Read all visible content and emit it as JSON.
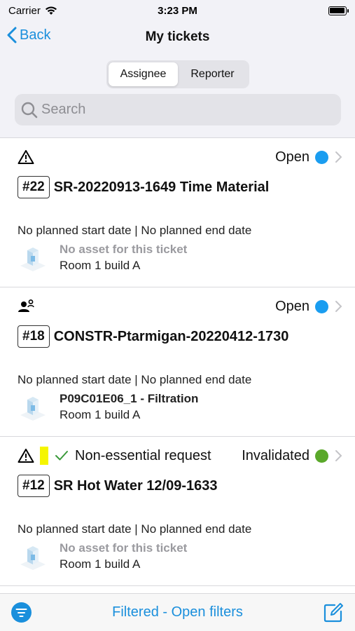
{
  "status_bar": {
    "carrier": "Carrier",
    "time": "3:23 PM"
  },
  "nav": {
    "back_label": "Back",
    "title": "My tickets"
  },
  "segments": [
    {
      "label": "Assignee",
      "active": true
    },
    {
      "label": "Reporter",
      "active": false
    }
  ],
  "search": {
    "placeholder": "Search"
  },
  "tickets": [
    {
      "number": "#22",
      "title": "SR-20220913-1649 Time Material",
      "type_icon": "warning-icon",
      "status": "Open",
      "status_color": "#1a9df0",
      "dates": "No planned start date | No planned end date",
      "asset": "No asset for this ticket",
      "location": "Room 1 build A"
    },
    {
      "number": "#18",
      "title": "CONSTR-Ptarmigan-20220412-1730",
      "type_icon": "people-icon",
      "status": "Open",
      "status_color": "#1a9df0",
      "dates": "No planned start date | No planned end date",
      "asset": "P09C01E06_1 - Filtration",
      "location": "Room 1 build A"
    },
    {
      "number": "#12",
      "title": "SR Hot Water 12/09-1633",
      "type_icon": "warning-icon",
      "request_type": "Non-essential request",
      "status": "Invalidated",
      "status_color": "#5aa82a",
      "dates": "No planned start date | No planned end date",
      "asset": "No asset for this ticket",
      "location": "Room 1 build A"
    }
  ],
  "bottom": {
    "filter_label": "Filtered - Open filters"
  }
}
